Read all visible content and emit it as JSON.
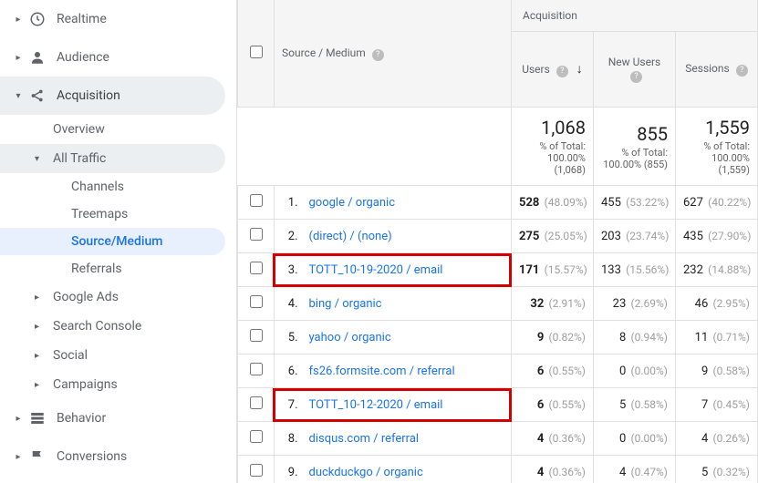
{
  "sidebar": {
    "top": [
      {
        "icon": "clock",
        "label": "Realtime"
      },
      {
        "icon": "user",
        "label": "Audience"
      }
    ],
    "acquisition": {
      "label": "Acquisition",
      "overview": "Overview",
      "alltraffic": {
        "label": "All Traffic",
        "items": [
          "Channels",
          "Treemaps",
          "Source/Medium",
          "Referrals"
        ]
      },
      "rest": [
        "Google Ads",
        "Search Console",
        "Social",
        "Campaigns"
      ]
    },
    "bottom": [
      {
        "icon": "behavior",
        "label": "Behavior"
      },
      {
        "icon": "flag",
        "label": "Conversions"
      }
    ]
  },
  "table": {
    "acq_header": "Acquisition",
    "src_header": "Source / Medium",
    "cols": [
      "Users",
      "New Users",
      "Sessions"
    ],
    "totals": {
      "users": {
        "big": "1,068",
        "sub": "% of Total: 100.00% (1,068)"
      },
      "newusers": {
        "big": "855",
        "sub": "% of Total: 100.00% (855)"
      },
      "sessions": {
        "big": "1,559",
        "sub": "% of Total: 100.00% (1,559)"
      }
    },
    "rows": [
      {
        "n": "1.",
        "src": "google / organic",
        "u": "528",
        "up": "(48.09%)",
        "ub": true,
        "nu": "455",
        "nup": "(53.22%)",
        "s": "627",
        "sp": "(40.22%)"
      },
      {
        "n": "2.",
        "src": "(direct) / (none)",
        "u": "275",
        "up": "(25.05%)",
        "ub": true,
        "nu": "203",
        "nup": "(23.74%)",
        "s": "435",
        "sp": "(27.90%)"
      },
      {
        "n": "3.",
        "src": "TOTT_10-19-2020 / email",
        "u": "171",
        "up": "(15.57%)",
        "ub": true,
        "nu": "133",
        "nup": "(15.56%)",
        "s": "232",
        "sp": "(14.88%)",
        "hl": true
      },
      {
        "n": "4.",
        "src": "bing / organic",
        "u": "32",
        "up": "(2.91%)",
        "ub": true,
        "nu": "23",
        "nup": "(2.69%)",
        "s": "46",
        "sp": "(2.95%)"
      },
      {
        "n": "5.",
        "src": "yahoo / organic",
        "u": "9",
        "up": "(0.82%)",
        "ub": true,
        "nu": "8",
        "nup": "(0.94%)",
        "s": "11",
        "sp": "(0.71%)"
      },
      {
        "n": "6.",
        "src": "fs26.formsite.com / referral",
        "u": "6",
        "up": "(0.55%)",
        "ub": true,
        "nu": "0",
        "nup": "(0.00%)",
        "s": "9",
        "sp": "(0.58%)"
      },
      {
        "n": "7.",
        "src": "TOTT_10-12-2020 / email",
        "u": "6",
        "up": "(0.55%)",
        "ub": true,
        "nu": "5",
        "nup": "(0.58%)",
        "s": "7",
        "sp": "(0.45%)",
        "hl": true
      },
      {
        "n": "8.",
        "src": "disqus.com / referral",
        "u": "4",
        "up": "(0.36%)",
        "ub": true,
        "nu": "0",
        "nup": "(0.00%)",
        "s": "4",
        "sp": "(0.26%)"
      },
      {
        "n": "9.",
        "src": "duckduckgo / organic",
        "u": "4",
        "up": "(0.36%)",
        "ub": true,
        "nu": "4",
        "nup": "(0.47%)",
        "s": "5",
        "sp": "(0.32%)"
      }
    ]
  }
}
